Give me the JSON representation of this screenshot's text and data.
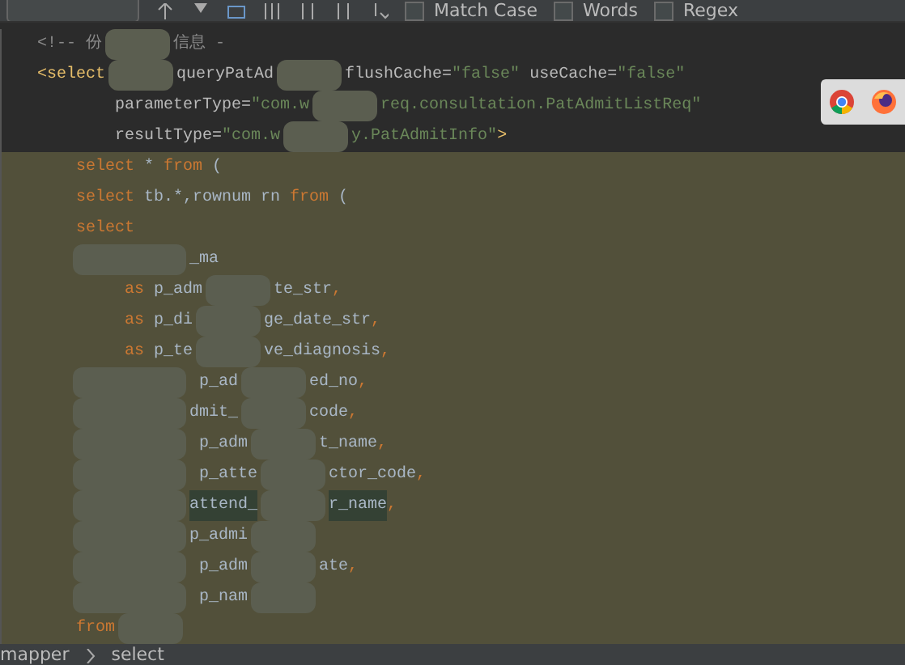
{
  "find_bar": {
    "options": [
      {
        "label": "Match Case",
        "checked": false
      },
      {
        "label": "Words",
        "checked": false
      },
      {
        "label": "Regex",
        "checked": false
      }
    ]
  },
  "editor": {
    "lines": [
      {
        "selected": false,
        "parts": [
          {
            "kind": "comment",
            "text": "<!-- 份"
          },
          {
            "kind": "mask"
          },
          {
            "kind": "comment",
            "text": "信息 -"
          }
        ]
      },
      {
        "selected": false,
        "parts": [
          {
            "kind": "tag",
            "text": "<select"
          },
          {
            "kind": "mask"
          },
          {
            "kind": "attr",
            "text": "queryPatAd"
          },
          {
            "kind": "mask"
          },
          {
            "kind": "attr",
            "text": "flushCache="
          },
          {
            "kind": "string",
            "text": "\"false\""
          },
          {
            "kind": "attr",
            "text": " useCache="
          },
          {
            "kind": "string",
            "text": "\"false\""
          }
        ]
      },
      {
        "selected": false,
        "parts": [
          {
            "kind": "attr",
            "text": "        parameterType="
          },
          {
            "kind": "string",
            "text": "\"com.w"
          },
          {
            "kind": "mask"
          },
          {
            "kind": "string",
            "text": "req.consultation.PatAdmitListReq\""
          }
        ]
      },
      {
        "selected": false,
        "parts": [
          {
            "kind": "attr",
            "text": "        resultType="
          },
          {
            "kind": "string",
            "text": "\"com.w"
          },
          {
            "kind": "mask"
          },
          {
            "kind": "string",
            "text": "y.PatAdmitInfo\""
          },
          {
            "kind": "tag",
            "text": ">"
          }
        ]
      },
      {
        "selected": true,
        "parts": [
          {
            "kind": "keyword",
            "text": "    select"
          },
          {
            "kind": "plain",
            "text": " * "
          },
          {
            "kind": "keyword",
            "text": "from"
          },
          {
            "kind": "plain",
            "text": " ("
          }
        ]
      },
      {
        "selected": true,
        "parts": [
          {
            "kind": "keyword",
            "text": "    select"
          },
          {
            "kind": "plain",
            "text": " tb.*,rownum rn "
          },
          {
            "kind": "keyword",
            "text": "from"
          },
          {
            "kind": "plain",
            "text": " ("
          }
        ]
      },
      {
        "selected": true,
        "parts": [
          {
            "kind": "keyword",
            "text": "    select"
          }
        ]
      },
      {
        "selected": true,
        "parts": [
          {
            "kind": "mask"
          },
          {
            "kind": "plain",
            "text": "_ma"
          }
        ]
      },
      {
        "selected": true,
        "parts": [
          {
            "kind": "keyword",
            "text": "         as"
          },
          {
            "kind": "plain",
            "text": " p_adm"
          },
          {
            "kind": "mask"
          },
          {
            "kind": "plain",
            "text": "te_str"
          },
          {
            "kind": "keyword",
            "text": ","
          }
        ]
      },
      {
        "selected": true,
        "parts": [
          {
            "kind": "keyword",
            "text": "         as"
          },
          {
            "kind": "plain",
            "text": " p_di"
          },
          {
            "kind": "mask"
          },
          {
            "kind": "plain",
            "text": "ge_date_str"
          },
          {
            "kind": "keyword",
            "text": ","
          }
        ]
      },
      {
        "selected": true,
        "parts": [
          {
            "kind": "keyword",
            "text": "         as"
          },
          {
            "kind": "plain",
            "text": " p_te"
          },
          {
            "kind": "mask"
          },
          {
            "kind": "plain",
            "text": "ve_diagnosis"
          },
          {
            "kind": "keyword",
            "text": ","
          }
        ]
      },
      {
        "selected": true,
        "parts": [
          {
            "kind": "mask"
          },
          {
            "kind": "plain",
            "text": " p_ad"
          },
          {
            "kind": "mask"
          },
          {
            "kind": "plain",
            "text": "ed_no"
          },
          {
            "kind": "keyword",
            "text": ","
          }
        ]
      },
      {
        "selected": true,
        "parts": [
          {
            "kind": "mask"
          },
          {
            "kind": "plain",
            "text": "dmit_"
          },
          {
            "kind": "mask"
          },
          {
            "kind": "plain",
            "text": "code"
          },
          {
            "kind": "keyword",
            "text": ","
          }
        ]
      },
      {
        "selected": true,
        "parts": [
          {
            "kind": "mask"
          },
          {
            "kind": "plain",
            "text": " p_adm"
          },
          {
            "kind": "mask"
          },
          {
            "kind": "plain",
            "text": "t_name"
          },
          {
            "kind": "keyword",
            "text": ","
          }
        ]
      },
      {
        "selected": true,
        "parts": [
          {
            "kind": "mask"
          },
          {
            "kind": "plain",
            "text": " p_atte"
          },
          {
            "kind": "mask"
          },
          {
            "kind": "plain",
            "text": "ctor_code"
          },
          {
            "kind": "keyword",
            "text": ","
          }
        ]
      },
      {
        "selected": true,
        "parts": [
          {
            "kind": "mask"
          },
          {
            "kind": "match",
            "text": "attend_"
          },
          {
            "kind": "mask"
          },
          {
            "kind": "match",
            "text": "r_name"
          },
          {
            "kind": "keyword",
            "text": ","
          }
        ]
      },
      {
        "selected": true,
        "parts": [
          {
            "kind": "mask"
          },
          {
            "kind": "plain",
            "text": "p_admi"
          },
          {
            "kind": "mask"
          }
        ]
      },
      {
        "selected": true,
        "parts": [
          {
            "kind": "mask"
          },
          {
            "kind": "plain",
            "text": " p_adm"
          },
          {
            "kind": "mask"
          },
          {
            "kind": "plain",
            "text": "ate"
          },
          {
            "kind": "keyword",
            "text": ","
          }
        ]
      },
      {
        "selected": true,
        "parts": [
          {
            "kind": "mask"
          },
          {
            "kind": "plain",
            "text": " p_nam"
          },
          {
            "kind": "mask"
          }
        ]
      },
      {
        "selected": true,
        "parts": [
          {
            "kind": "keyword",
            "text": "    from"
          },
          {
            "kind": "mask"
          }
        ]
      }
    ]
  },
  "breadcrumb": [
    "mapper",
    "select"
  ]
}
